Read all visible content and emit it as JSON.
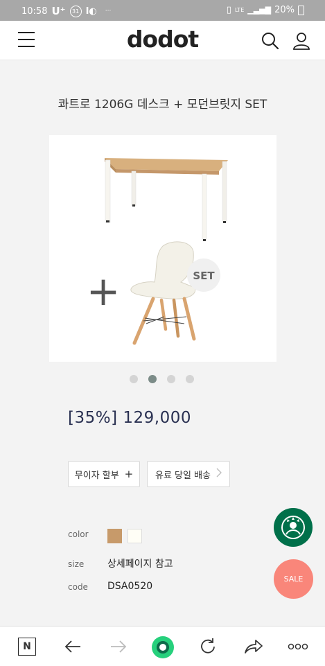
{
  "status_bar": {
    "time": "10:58",
    "carrier": "U⁺",
    "calendar_day": "31",
    "more": "···",
    "network": "LTE",
    "battery": "20%"
  },
  "header": {
    "logo": "dodot"
  },
  "product": {
    "title": "콰트로 1206G 데스크 + 모던브릿지 SET",
    "image_badge": "SET",
    "image_plus": "+",
    "price": "[35%] 129,000",
    "carousel_total": 4,
    "carousel_active": 2
  },
  "buttons": {
    "installment": "무이자 할부",
    "installment_icon": "+",
    "delivery": "유료 당일 배송"
  },
  "info": {
    "color_label": "color",
    "color_options": [
      "#c79a6a",
      "#fffef6"
    ],
    "size_label": "size",
    "size_value": "상세페이지 참고",
    "code_label": "code",
    "code_value": "DSA0520"
  },
  "floating": {
    "sale_label": "SALE"
  },
  "colors": {
    "accent_price": "#2a3152",
    "sale": "#f9867a",
    "starbucks": "#00704a",
    "browser_green": "#26d07c"
  },
  "bottom_nav": {
    "home_letter": "N"
  }
}
